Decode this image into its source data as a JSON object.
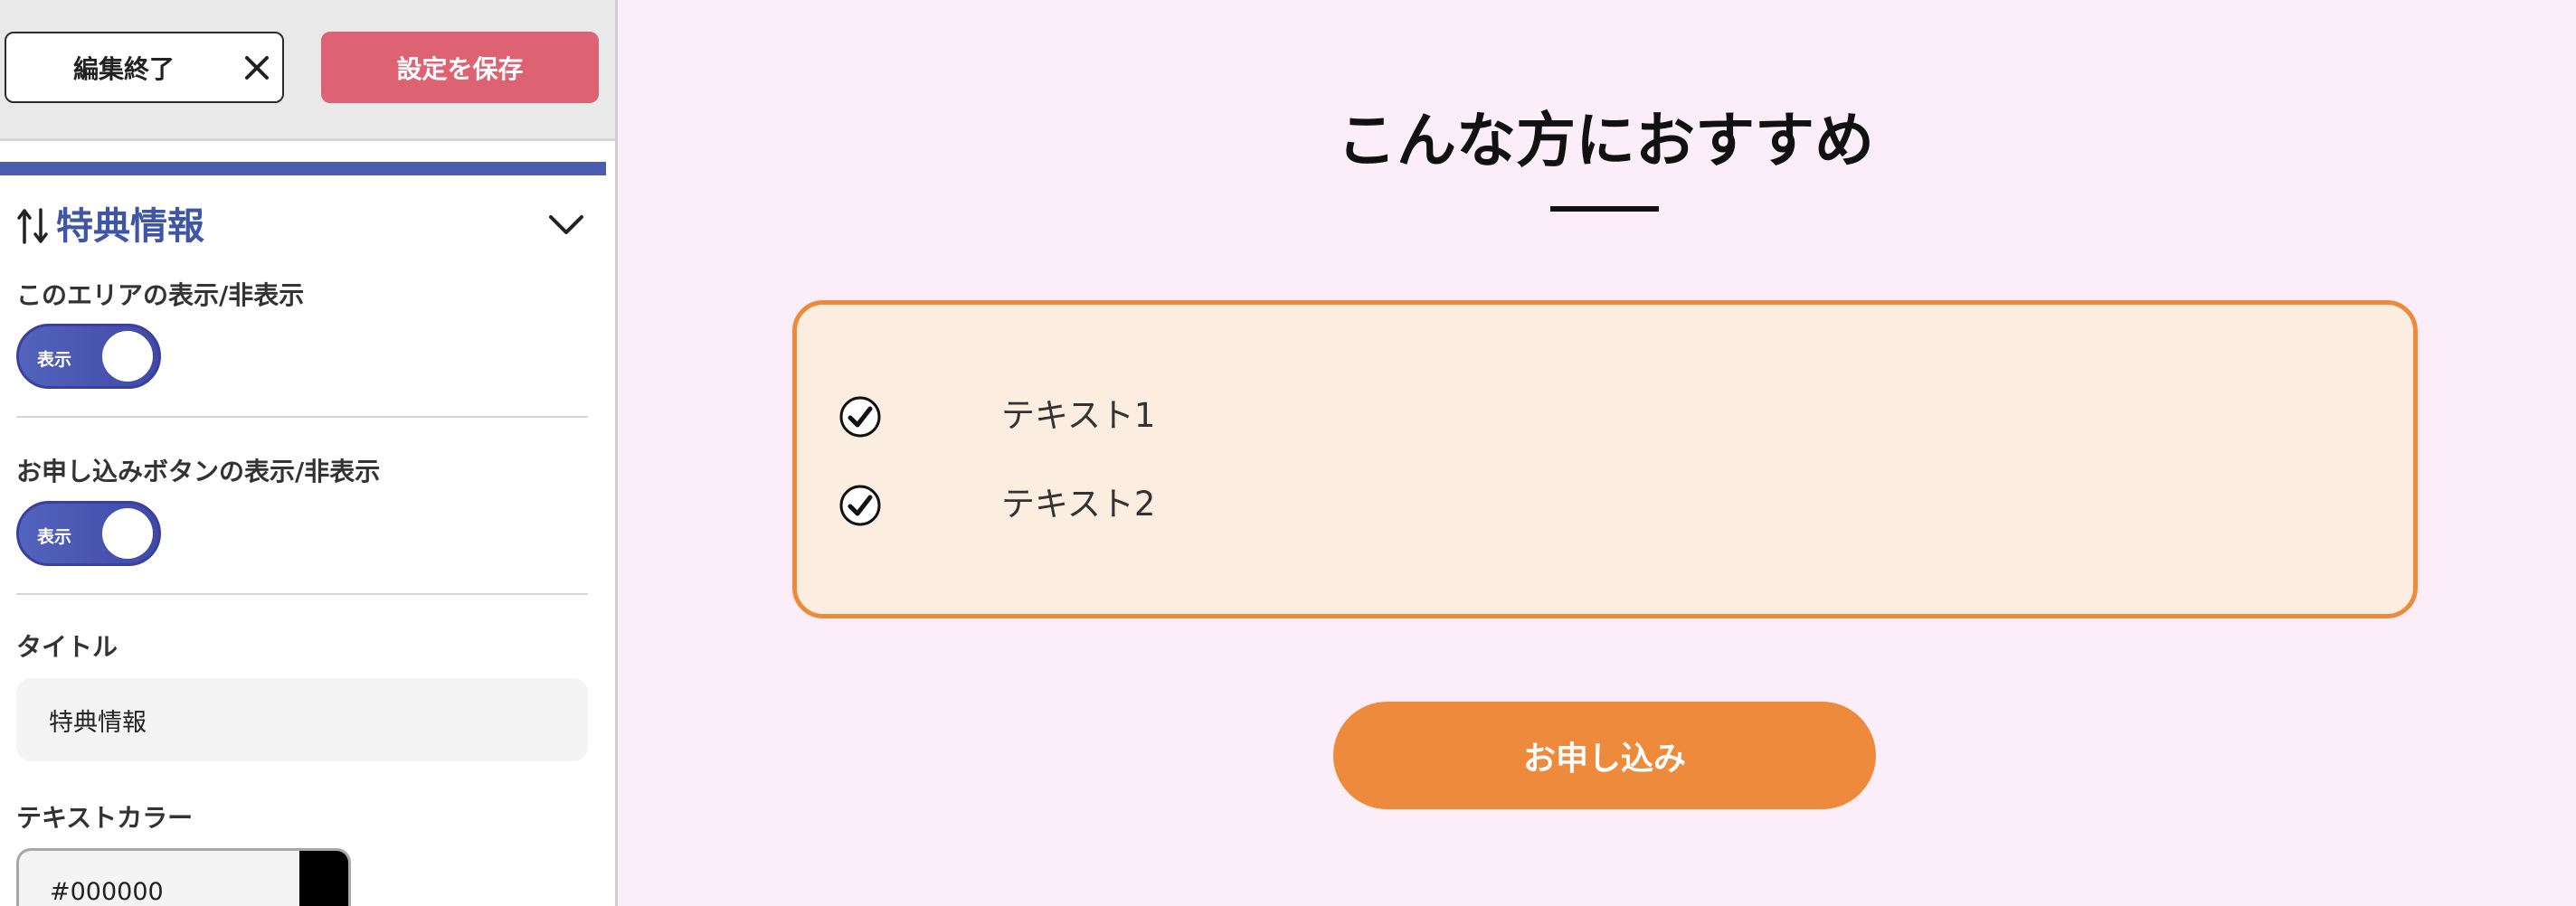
{
  "toolbar": {
    "close_label": "編集終了",
    "save_label": "設定を保存",
    "save_color": "#dd6272"
  },
  "panel": {
    "title": "特典情報",
    "accent_color": "#4a5db0",
    "area_visibility": {
      "label": "このエリアの表示/非表示",
      "toggle_label": "表示",
      "on": true
    },
    "apply_button_visibility": {
      "label": "お申し込みボタンの表示/非表示",
      "toggle_label": "表示",
      "on": true
    },
    "title_field": {
      "label": "タイトル",
      "value": "特典情報"
    },
    "text_color_field": {
      "label": "テキストカラー",
      "value": "#000000",
      "swatch_color": "#000000"
    }
  },
  "preview": {
    "heading": "こんな方におすすめ",
    "items": [
      {
        "text": "テキスト1",
        "icon": "check-circle-icon"
      },
      {
        "text": "テキスト2",
        "icon": "check-circle-icon"
      }
    ],
    "box_border_color": "#ee8a3b",
    "box_bg_color": "#fbeee1",
    "button_label": "お申し込み",
    "button_color": "#ee8a3b",
    "background_color": "#fbeef9"
  }
}
